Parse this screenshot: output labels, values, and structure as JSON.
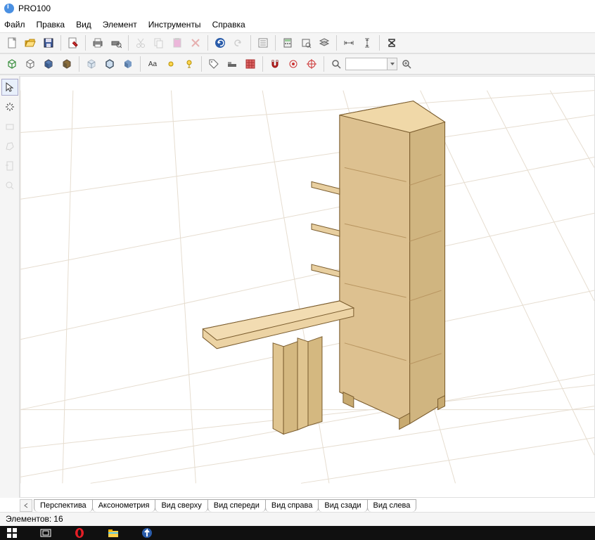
{
  "title": "PRO100",
  "menu": [
    "Файл",
    "Правка",
    "Вид",
    "Элемент",
    "Инструменты",
    "Справка"
  ],
  "tabs": [
    "Перспектива",
    "Аксонометрия",
    "Вид сверху",
    "Вид спереди",
    "Вид справа",
    "Вид сзади",
    "Вид слева"
  ],
  "status_label": "Элементов:",
  "status_count": "16",
  "search_value": ""
}
